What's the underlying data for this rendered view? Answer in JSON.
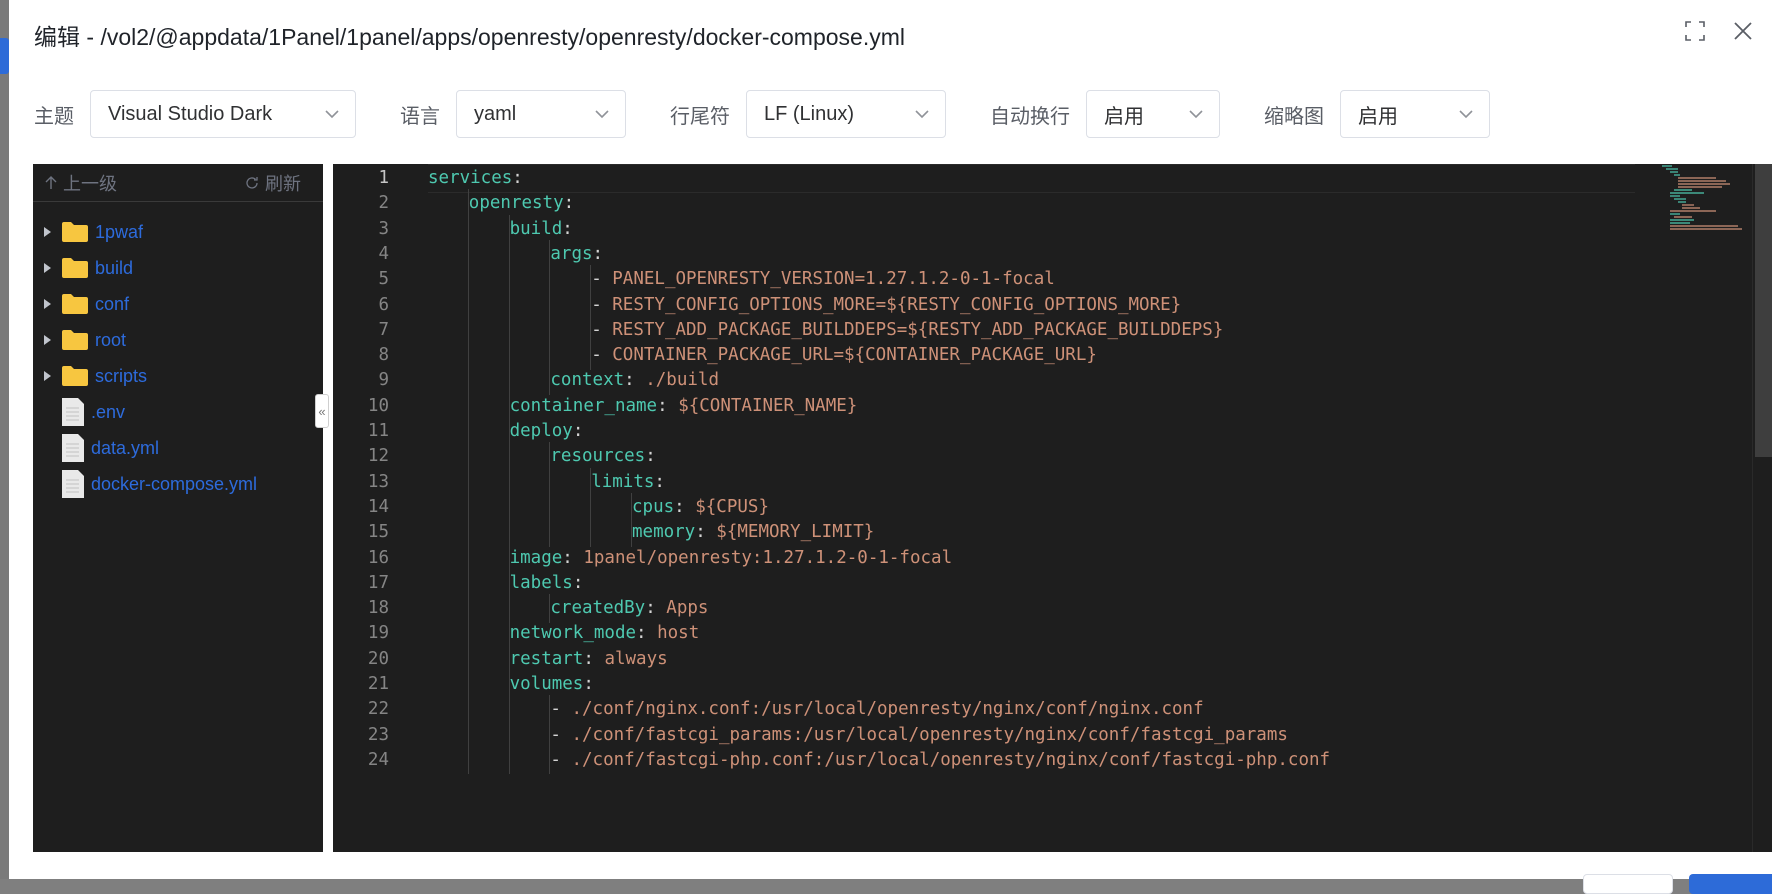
{
  "dialog": {
    "title": "编辑 - /vol2/@appdata/1Panel/1panel/apps/openresty/openresty/docker-compose.yml",
    "fullscreen_icon": "fullscreen-icon",
    "close_icon": "close-icon"
  },
  "toolbar": {
    "theme": {
      "label": "主题",
      "value": "Visual Studio Dark"
    },
    "language": {
      "label": "语言",
      "value": "yaml"
    },
    "eol": {
      "label": "行尾符",
      "value": "LF (Linux)"
    },
    "wrap": {
      "label": "自动换行",
      "value": "启用"
    },
    "minimap": {
      "label": "缩略图",
      "value": "启用"
    }
  },
  "sidebar": {
    "up_label": "上一级",
    "refresh_label": "刷新",
    "items": [
      {
        "name": "1pwaf",
        "type": "folder"
      },
      {
        "name": "build",
        "type": "folder"
      },
      {
        "name": "conf",
        "type": "folder"
      },
      {
        "name": "root",
        "type": "folder"
      },
      {
        "name": "scripts",
        "type": "folder"
      },
      {
        "name": ".env",
        "type": "file"
      },
      {
        "name": "data.yml",
        "type": "file"
      },
      {
        "name": "docker-compose.yml",
        "type": "file"
      }
    ]
  },
  "editor": {
    "active_line": 1,
    "lines": [
      {
        "n": "1",
        "indent": 0,
        "key": "services",
        "colon": ":",
        "value": ""
      },
      {
        "n": "2",
        "indent": 1,
        "key": "openresty",
        "colon": ":",
        "value": ""
      },
      {
        "n": "3",
        "indent": 2,
        "key": "build",
        "colon": ":",
        "value": ""
      },
      {
        "n": "4",
        "indent": 3,
        "key": "args",
        "colon": ":",
        "value": ""
      },
      {
        "n": "5",
        "indent": 4,
        "key": "",
        "colon": "",
        "dash": "- ",
        "value": "PANEL_OPENRESTY_VERSION=1.27.1.2-0-1-focal"
      },
      {
        "n": "6",
        "indent": 4,
        "key": "",
        "colon": "",
        "dash": "- ",
        "value": "RESTY_CONFIG_OPTIONS_MORE=${RESTY_CONFIG_OPTIONS_MORE}"
      },
      {
        "n": "7",
        "indent": 4,
        "key": "",
        "colon": "",
        "dash": "- ",
        "value": "RESTY_ADD_PACKAGE_BUILDDEPS=${RESTY_ADD_PACKAGE_BUILDDEPS}"
      },
      {
        "n": "8",
        "indent": 4,
        "key": "",
        "colon": "",
        "dash": "- ",
        "value": "CONTAINER_PACKAGE_URL=${CONTAINER_PACKAGE_URL}"
      },
      {
        "n": "9",
        "indent": 3,
        "key": "context",
        "colon": ": ",
        "value": "./build"
      },
      {
        "n": "10",
        "indent": 2,
        "key": "container_name",
        "colon": ": ",
        "value": "${CONTAINER_NAME}"
      },
      {
        "n": "11",
        "indent": 2,
        "key": "deploy",
        "colon": ":",
        "value": ""
      },
      {
        "n": "12",
        "indent": 3,
        "key": "resources",
        "colon": ":",
        "value": ""
      },
      {
        "n": "13",
        "indent": 4,
        "key": "limits",
        "colon": ":",
        "value": ""
      },
      {
        "n": "14",
        "indent": 5,
        "key": "cpus",
        "colon": ": ",
        "value": "${CPUS}"
      },
      {
        "n": "15",
        "indent": 5,
        "key": "memory",
        "colon": ": ",
        "value": "${MEMORY_LIMIT}"
      },
      {
        "n": "16",
        "indent": 2,
        "key": "image",
        "colon": ": ",
        "value": "1panel/openresty:1.27.1.2-0-1-focal"
      },
      {
        "n": "17",
        "indent": 2,
        "key": "labels",
        "colon": ":",
        "value": ""
      },
      {
        "n": "18",
        "indent": 3,
        "key": "createdBy",
        "colon": ": ",
        "value": "Apps"
      },
      {
        "n": "19",
        "indent": 2,
        "key": "network_mode",
        "colon": ": ",
        "value": "host"
      },
      {
        "n": "20",
        "indent": 2,
        "key": "restart",
        "colon": ": ",
        "value": "always"
      },
      {
        "n": "21",
        "indent": 2,
        "key": "volumes",
        "colon": ":",
        "value": ""
      },
      {
        "n": "22",
        "indent": 3,
        "key": "",
        "colon": "",
        "dash": "- ",
        "value": "./conf/nginx.conf:/usr/local/openresty/nginx/conf/nginx.conf"
      },
      {
        "n": "23",
        "indent": 3,
        "key": "",
        "colon": "",
        "dash": "- ",
        "value": "./conf/fastcgi_params:/usr/local/openresty/nginx/conf/fastcgi_params"
      },
      {
        "n": "24",
        "indent": 3,
        "key": "",
        "colon": "",
        "dash": "- ",
        "value": "./conf/fastcgi-php.conf:/usr/local/openresty/nginx/conf/fastcgi-php.conf"
      }
    ]
  },
  "colors": {
    "key": "#4ec9b0",
    "string": "#ce9178",
    "punct": "#d4d4d4",
    "editor_bg": "#1e1e1e",
    "link": "#2d6bdc",
    "folder": "#f7c640"
  }
}
